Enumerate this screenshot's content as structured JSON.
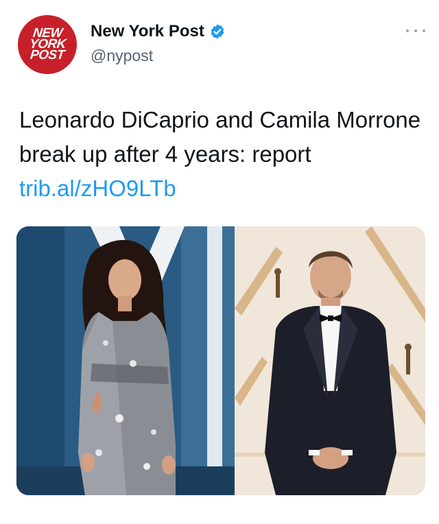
{
  "account": {
    "avatar_text": [
      "NEW",
      "YORK",
      "POST"
    ],
    "display_name": "New York Post",
    "handle": "@nypost",
    "verified": true,
    "avatar_icon": "new-york-post-logo",
    "verified_icon": "verified-badge-icon",
    "more_icon": "more-options-icon"
  },
  "tweet": {
    "text": "Leonardo DiCaprio and Camila Morrone break up after 4 years: report",
    "link": "trib.al/zHO9LTb"
  },
  "media": {
    "left_photo": "photo-of-woman-in-sequin-dress",
    "right_photo": "photo-of-man-in-tuxedo"
  },
  "colors": {
    "brand_red": "#c8202a",
    "link_blue": "#1d9bf0",
    "handle_gray": "#536471",
    "text": "#0f1419"
  }
}
